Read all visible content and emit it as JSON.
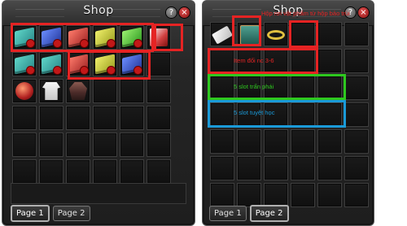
{
  "left_panel": {
    "title": "Shop",
    "help_label": "?",
    "close_label": "×",
    "tabs": [
      "Page 1",
      "Page 2"
    ]
  },
  "right_panel": {
    "title": "Shop",
    "help_label": "?",
    "close_label": "×",
    "tabs": [
      "Page 1",
      "Page 2"
    ],
    "annotations": {
      "top": "Hộp rơi vật phẩm từ hộp bảo trùi",
      "red_row": "Item đổi nc 3-6",
      "green_row": "5 slot trấn phái",
      "blue_row": "5 slot tuyệt học"
    }
  },
  "colors": {
    "red": "#e52323",
    "green": "#2ec81f",
    "blue": "#1a9ad8",
    "annotation_red": "#e52323",
    "annotation_green": "#2ec81f",
    "annotation_blue": "#1a9ad8"
  },
  "items": {
    "left_row1": [
      "teal-book",
      "blue-book",
      "red-book",
      "yellow-book",
      "green-book",
      "red-pouch"
    ],
    "left_row2": [
      "teal-book",
      "teal-book",
      "red-book",
      "yellow-book",
      "blue-book"
    ],
    "left_row3": [
      "red-gift-bag",
      "white-robe",
      "armor"
    ],
    "right_row1": [
      "white-scroll",
      "treasure-box",
      "gold-ring"
    ]
  }
}
